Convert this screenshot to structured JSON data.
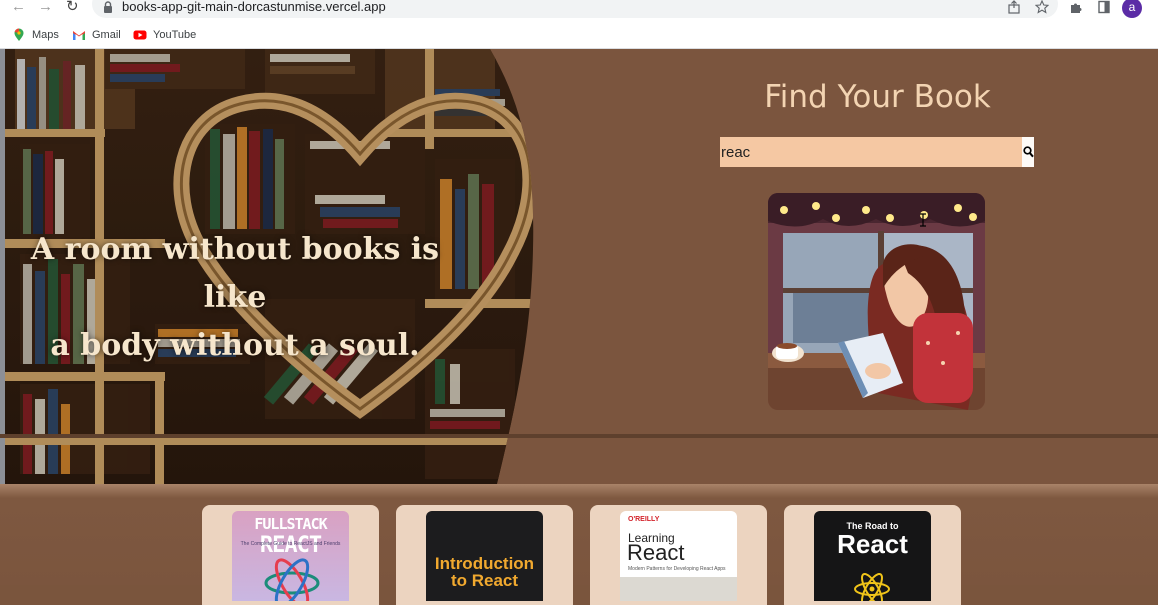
{
  "browser": {
    "url": "books-app-git-main-dorcastunmise.vercel.app",
    "avatar_letter": "a",
    "bookmarks": [
      {
        "label": "Maps",
        "icon": "maps-pin-icon"
      },
      {
        "label": "Gmail",
        "icon": "gmail-icon"
      },
      {
        "label": "YouTube",
        "icon": "youtube-icon"
      }
    ]
  },
  "hero": {
    "quote_line1": "A room without books is like",
    "quote_line2": "a body without a soul.",
    "title": "Find Your Book",
    "search_value": "reac"
  },
  "results": {
    "books": [
      {
        "title_line1": "FULLSTACK",
        "title_line2": "REACT",
        "subtitle": "The Complete Guide to ReactJS and Friends"
      },
      {
        "title_line1": "Introduction",
        "title_line2": "to React",
        "subtitle": ""
      },
      {
        "publisher": "O'REILLY",
        "title_line1": "Learning",
        "title_line2": "React",
        "subtitle": "Modern Patterns for Developing React Apps"
      },
      {
        "title_line1": "The Road to",
        "title_line2": "React",
        "subtitle": ""
      }
    ]
  },
  "colors": {
    "page_bg": "#7b553e",
    "title": "#f3d4b2",
    "search_bg": "#f5c8a3",
    "card_bg": "#ecd4c0"
  }
}
